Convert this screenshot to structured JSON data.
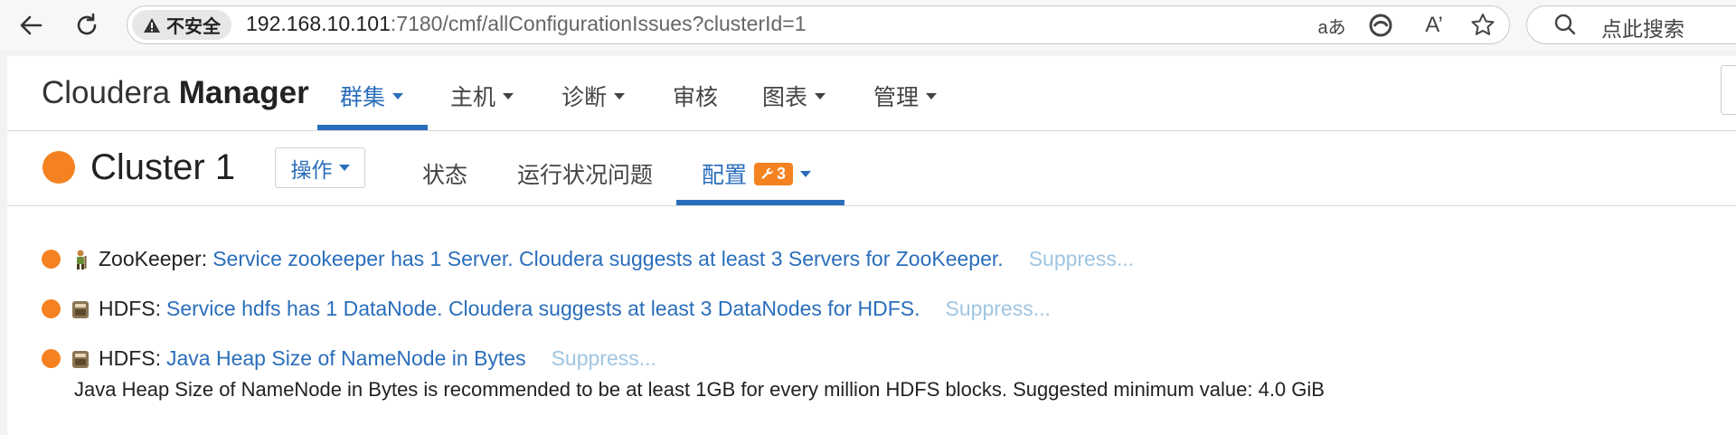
{
  "browser": {
    "security_label": "不安全",
    "url_host": "192.168.10.101",
    "url_rest": ":7180/cmf/allConfigurationIssues?clusterId=1",
    "search_placeholder": "点此搜索",
    "read_aloud_glyph": "A’",
    "translate_glyph": "aあ"
  },
  "nav": {
    "brand_light": "Cloudera ",
    "brand_bold": "Manager",
    "items": [
      {
        "label": "群集",
        "dropdown": true,
        "active": true
      },
      {
        "label": "主机",
        "dropdown": true
      },
      {
        "label": "诊断",
        "dropdown": true
      },
      {
        "label": "审核",
        "dropdown": false
      },
      {
        "label": "图表",
        "dropdown": true
      },
      {
        "label": "管理",
        "dropdown": true
      }
    ]
  },
  "cluster": {
    "name": "Cluster 1",
    "status_color": "#f58220",
    "actions_label": "操作",
    "tabs": [
      {
        "label": "状态"
      },
      {
        "label": "运行状况问题"
      },
      {
        "label": "配置",
        "badge": "3",
        "active": true
      }
    ]
  },
  "issues": [
    {
      "service": "ZooKeeper:",
      "icon": "zookeeper-icon",
      "message": "Service zookeeper has 1 Server. Cloudera suggests at least 3 Servers for ZooKeeper.",
      "suppress": "Suppress..."
    },
    {
      "service": "HDFS:",
      "icon": "hdfs-icon",
      "message": "Service hdfs has 1 DataNode. Cloudera suggests at least 3 DataNodes for HDFS.",
      "suppress": "Suppress..."
    },
    {
      "service": "HDFS:",
      "icon": "hdfs-icon",
      "message": "Java Heap Size of NameNode in Bytes",
      "suppress": "Suppress...",
      "detail": "Java Heap Size of NameNode in Bytes is recommended to be at least 1GB for every million HDFS blocks. Suggested minimum value: 4.0 GiB"
    }
  ],
  "colors": {
    "accent": "#2a6ebb",
    "warning": "#f58220",
    "suppress": "#9fc5e2"
  }
}
